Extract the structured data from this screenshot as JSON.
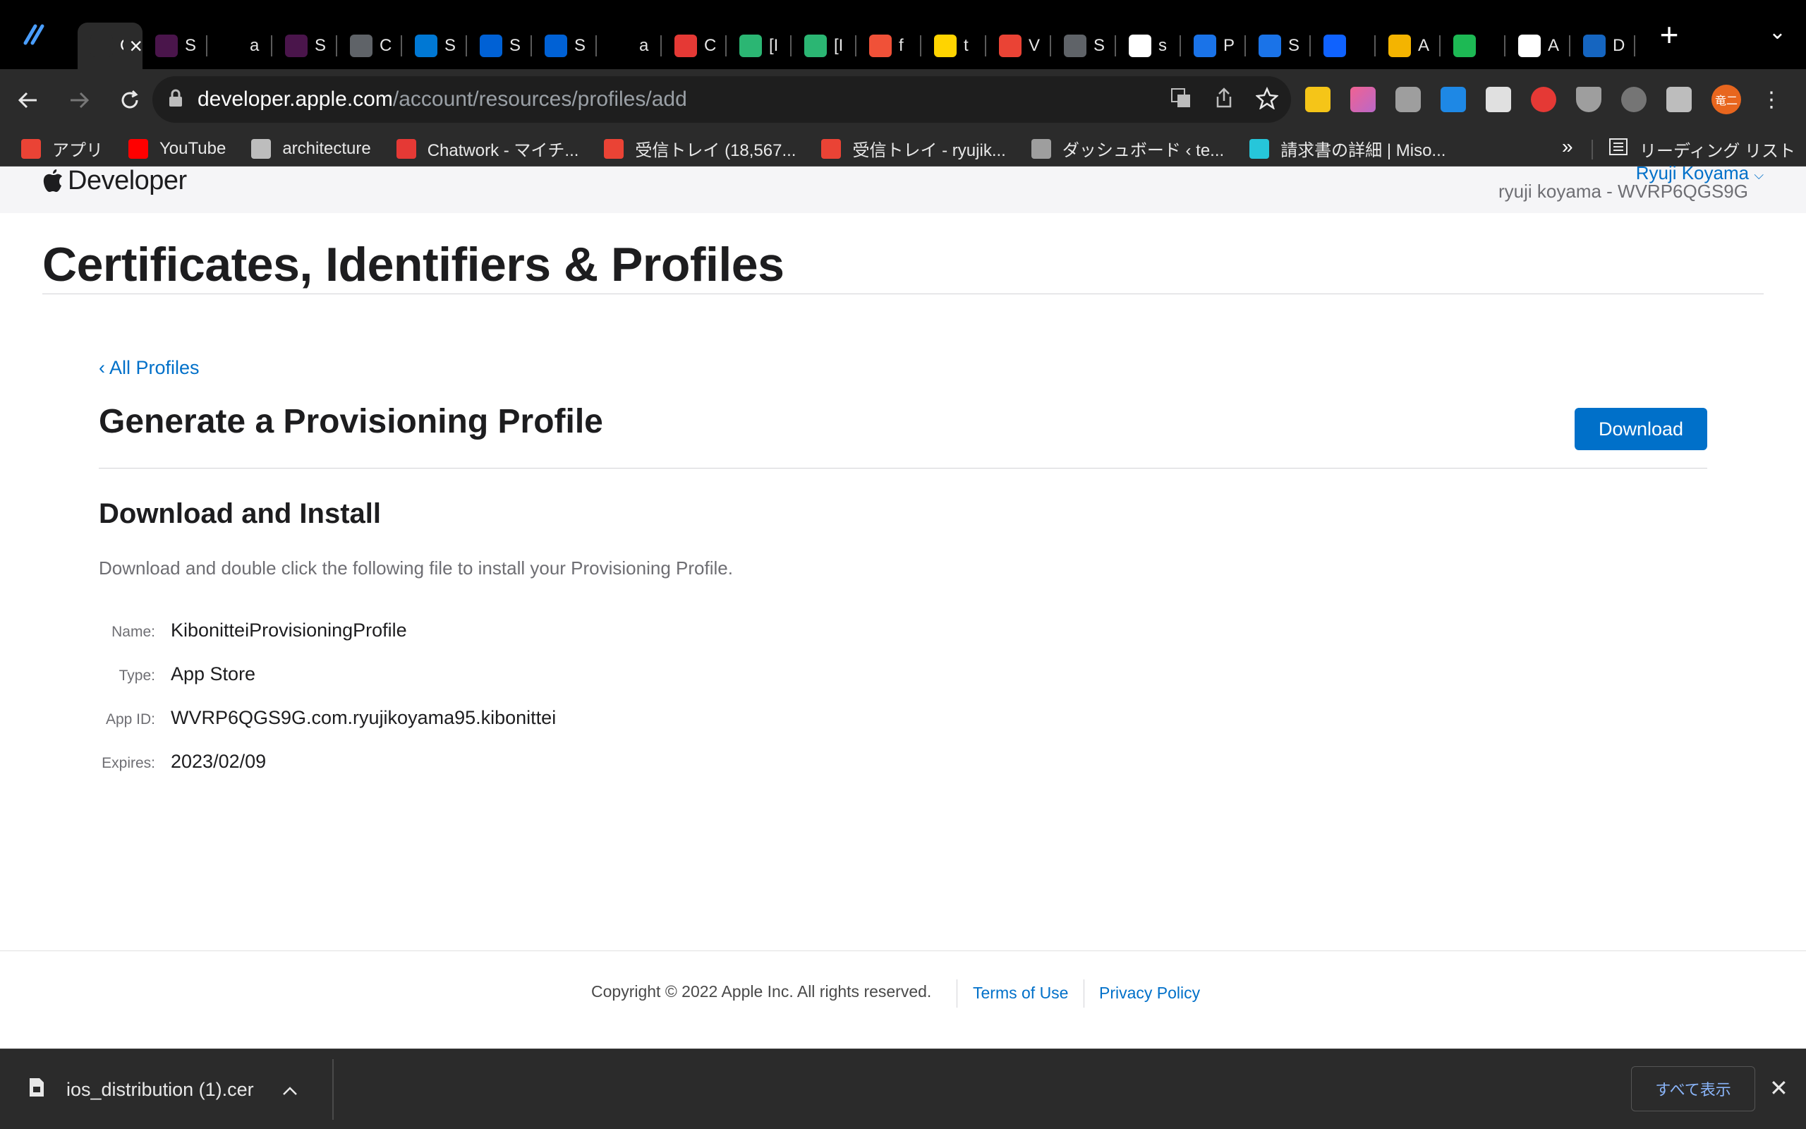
{
  "browser": {
    "tabs": [
      {
        "label": "Ce",
        "icon": "apple-icon",
        "color": "#2b2b2b",
        "active": true
      },
      {
        "label": "S",
        "icon": "slack-icon",
        "color": "#4a154b"
      },
      {
        "label": "a",
        "icon": "github-icon",
        "color": "#000000"
      },
      {
        "label": "S",
        "icon": "slack-icon",
        "color": "#4a154b"
      },
      {
        "label": "C",
        "icon": "globe-icon",
        "color": "#5f6368"
      },
      {
        "label": "S",
        "icon": "azure-icon",
        "color": "#0078d4"
      },
      {
        "label": "S",
        "icon": "box-icon",
        "color": "#0061d5"
      },
      {
        "label": "S",
        "icon": "box-icon",
        "color": "#0061d5"
      },
      {
        "label": "a",
        "icon": "github-icon",
        "color": "#000000"
      },
      {
        "label": "C",
        "icon": "chatwork-icon",
        "color": "#e53935"
      },
      {
        "label": "[I",
        "icon": "b-icon",
        "color": "#2bb673"
      },
      {
        "label": "[I",
        "icon": "b-icon",
        "color": "#2bb673"
      },
      {
        "label": "f",
        "icon": "swift-icon",
        "color": "#f05138"
      },
      {
        "label": "t",
        "icon": "t-icon",
        "color": "#ffd400"
      },
      {
        "label": "V",
        "icon": "gmail-icon",
        "color": "#ea4335"
      },
      {
        "label": "S",
        "icon": "globe-icon",
        "color": "#5f6368"
      },
      {
        "label": "s",
        "icon": "google-icon",
        "color": "#ffffff"
      },
      {
        "label": "P",
        "icon": "app-icon",
        "color": "#1a73e8"
      },
      {
        "label": "S",
        "icon": "app-icon",
        "color": "#1a73e8"
      },
      {
        "label": "",
        "icon": "ut-icon",
        "color": "#0f62fe"
      },
      {
        "label": "A",
        "icon": "a-icon",
        "color": "#f4b400"
      },
      {
        "label": "",
        "icon": "circle-icon",
        "color": "#1db954"
      },
      {
        "label": "A",
        "icon": "google-icon",
        "color": "#ffffff"
      },
      {
        "label": "D",
        "icon": "d-icon",
        "color": "#1565c0"
      }
    ],
    "url_host": "developer.apple.com",
    "url_path": "/account/resources/profiles/add",
    "profile_initials": "竜二",
    "bookmarks": [
      {
        "label": "アプリ",
        "color": "#ea4335"
      },
      {
        "label": "YouTube",
        "color": "#ff0000"
      },
      {
        "label": "architecture",
        "color": "#bdbdbd"
      },
      {
        "label": "Chatwork - マイチ...",
        "color": "#e53935"
      },
      {
        "label": "受信トレイ (18,567...",
        "color": "#ea4335"
      },
      {
        "label": "受信トレイ - ryujik...",
        "color": "#ea4335"
      },
      {
        "label": "ダッシュボード ‹ te...",
        "color": "#9e9e9e"
      },
      {
        "label": "請求書の詳細 | Miso...",
        "color": "#26c6da"
      }
    ],
    "bookmarks_more": "»",
    "reading_list": "リーディング リスト"
  },
  "header": {
    "brand": "Developer",
    "user": "Ryuji Koyama",
    "team": "ryuji koyama - WVRP6QGS9G"
  },
  "page": {
    "title": "Certificates, Identifiers & Profiles",
    "back_link": "‹ All Profiles",
    "section_title": "Generate a Provisioning Profile",
    "download_label": "Download",
    "sub_title": "Download and Install",
    "description": "Download and double click the following file to install your Provisioning Profile.",
    "details": [
      {
        "label": "Name:",
        "value": "KibonitteiProvisioningProfile"
      },
      {
        "label": "Type:",
        "value": "App Store"
      },
      {
        "label": "App ID:",
        "value": "WVRP6QGS9G.com.ryujikoyama95.kibonittei"
      },
      {
        "label": "Expires:",
        "value": "2023/02/09"
      }
    ]
  },
  "footer": {
    "copyright": "Copyright © 2022 Apple Inc. All rights reserved.",
    "terms": "Terms of Use",
    "privacy": "Privacy Policy"
  },
  "downloads": {
    "file_name": "ios_distribution (1).cer",
    "show_all": "すべて表示"
  }
}
